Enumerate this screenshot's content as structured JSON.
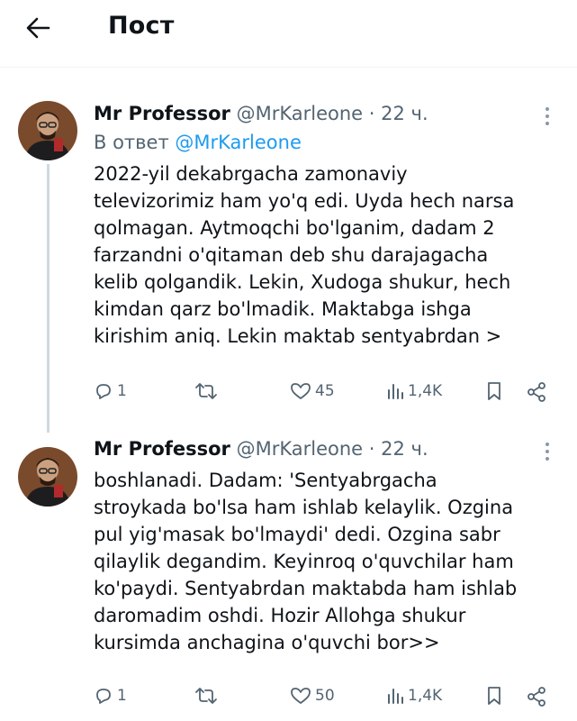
{
  "header": {
    "title": "Пост",
    "back_icon": "arrow-left-icon"
  },
  "posts": [
    {
      "author_name": "Mr Professor",
      "handle": "@MrKarleone",
      "separator": "·",
      "time": "22 ч.",
      "reply_prefix": "В ответ",
      "reply_handle": "@MrKarleone",
      "text_lines": [
        "2022-yil dekabrgacha zamonaviy",
        "televizorimiz ham yo'q edi. Uyda hech narsa",
        "qolmagan. Aytmoqchi bo'lganim, dadam 2",
        "farzandni o'qitaman deb shu darajagacha",
        "kelib qolgandik. Lekin, Xudoga shukur, hech",
        "kimdan qarz bo'lmadik. Maktabga ishga",
        "kirishim aniq. Lekin maktab sentyabrdan >"
      ],
      "replies": "1",
      "likes": "45",
      "views": "1,4K"
    },
    {
      "author_name": "Mr Professor",
      "handle": "@MrKarleone",
      "separator": "·",
      "time": "22 ч.",
      "text_lines": [
        "boshlanadi. Dadam: 'Sentyabrgacha",
        "stroykada bo'lsa ham ishlab kelaylik. Ozgina",
        "pul yig'masak bo'lmaydi' dedi. Ozgina sabr",
        "qilaylik degandim. Keyinroq o'quvchilar ham",
        "ko'paydi. Sentyabrdan maktabda ham ishlab",
        "daromadim oshdi. Hozir Allohga shukur",
        "kursimda anchagina o'quvchi bor>>"
      ],
      "replies": "1",
      "likes": "50",
      "views": "1,4K"
    }
  ],
  "colors": {
    "text": "#0f1419",
    "secondary": "#536471",
    "link": "#1d9bf0",
    "thread": "#cfd9de"
  }
}
